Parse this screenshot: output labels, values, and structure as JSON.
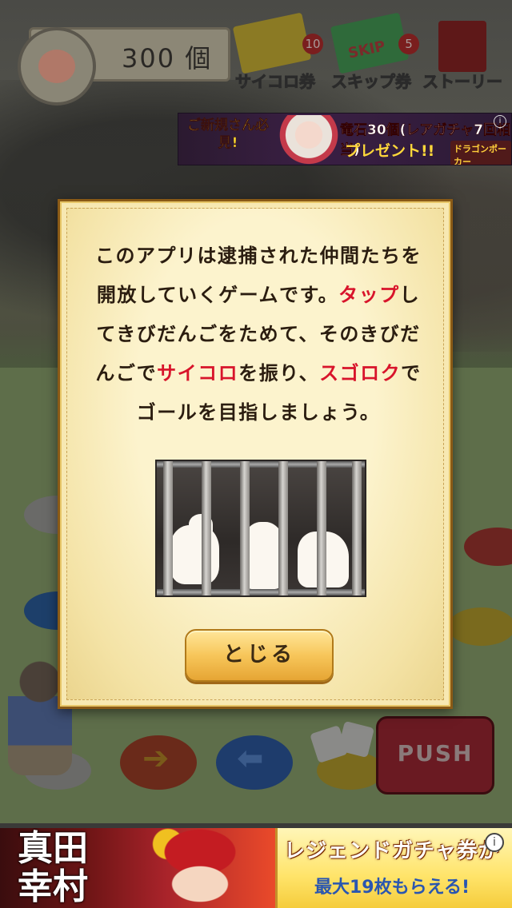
{
  "hud": {
    "dango_count": "300 個",
    "dice_ticket_label": "サイコロ券",
    "dice_ticket_count": "10",
    "skip_ticket_label": "スキップ券",
    "skip_ticket_text": "SKIP",
    "skip_ticket_count": "5",
    "story_label": "ストーリー"
  },
  "ad_top": {
    "new_user": "ご新規さん必見!",
    "line1": "竜石30個(レアガチャ7回相当)",
    "line2": "プレゼント!!",
    "logo": "ドラゴンポーカー",
    "info": "i"
  },
  "modal": {
    "text_1": "このアプリは逮捕された仲間たちを開放していくゲームです。",
    "text_2a": "タップ",
    "text_2b": "してきびだんごをためて、そのきびだんごで",
    "text_2c": "サイコロ",
    "text_2d": "を振り、",
    "text_2e": "スゴロク",
    "text_2f": "でゴールを目指しましょう。",
    "close_label": "とじる"
  },
  "controls": {
    "push_label": "PUSH",
    "arrow_right": "➔",
    "arrow_left": "⬅"
  },
  "ad_bottom": {
    "kanji": "真田幸村",
    "line1": "レジェンドガチャ券が",
    "line2": "最大19枚もらえる!",
    "info": "i"
  },
  "colors": {
    "accent_red": "#d8142b",
    "modal_bg": "#f7e8b2",
    "button_gold": "#f7c65a"
  }
}
